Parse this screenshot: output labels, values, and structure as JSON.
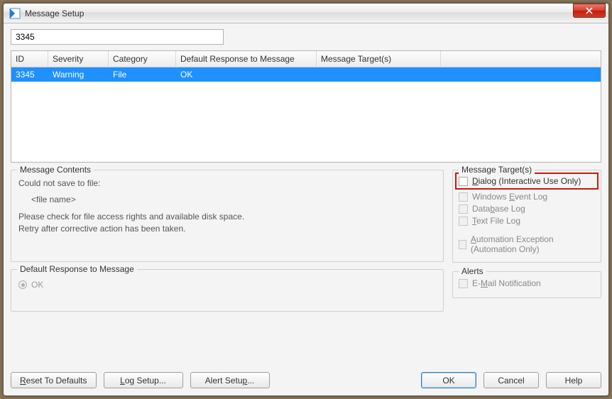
{
  "window": {
    "title": "Message Setup"
  },
  "search": {
    "value": "3345"
  },
  "grid": {
    "headers": {
      "id": "ID",
      "severity": "Severity",
      "category": "Category",
      "response": "Default Response to Message",
      "targets": "Message Target(s)"
    },
    "rows": [
      {
        "id": "3345",
        "severity": "Warning",
        "category": "File",
        "response": "OK",
        "targets": ""
      }
    ]
  },
  "contents": {
    "legend": "Message Contents",
    "line1": "Could not save to file:",
    "placeholder": "<file name>",
    "line3": "Please check for file access rights and available disk space.",
    "line4": "Retry after corrective action has been taken."
  },
  "default_response": {
    "legend": "Default Response to Message",
    "option_ok": "OK"
  },
  "targets": {
    "legend": "Message Target(s)",
    "dialog_pre": "",
    "dialog_u": "D",
    "dialog_post": "ialog (Interactive Use Only)",
    "welog_pre": "Windows ",
    "welog_u": "E",
    "welog_post": "vent Log",
    "dblog_pre": "Data",
    "dblog_u": "b",
    "dblog_post": "ase Log",
    "txtlog_pre": "",
    "txtlog_u": "T",
    "txtlog_post": "ext File Log",
    "autoex_pre": "",
    "autoex_u": "A",
    "autoex_post": "utomation Exception (Automation Only)"
  },
  "alerts": {
    "legend": "Alerts",
    "email_pre": "E-",
    "email_u": "M",
    "email_post": "ail Notification"
  },
  "buttons": {
    "reset_pre": "",
    "reset_u": "R",
    "reset_post": "eset To Defaults",
    "logsetup_pre": "",
    "logsetup_u": "L",
    "logsetup_post": "og Setup...",
    "alertsetup_pre": "Alert Setu",
    "alertsetup_u": "p",
    "alertsetup_post": "...",
    "ok": "OK",
    "cancel": "Cancel",
    "help": "Help"
  }
}
